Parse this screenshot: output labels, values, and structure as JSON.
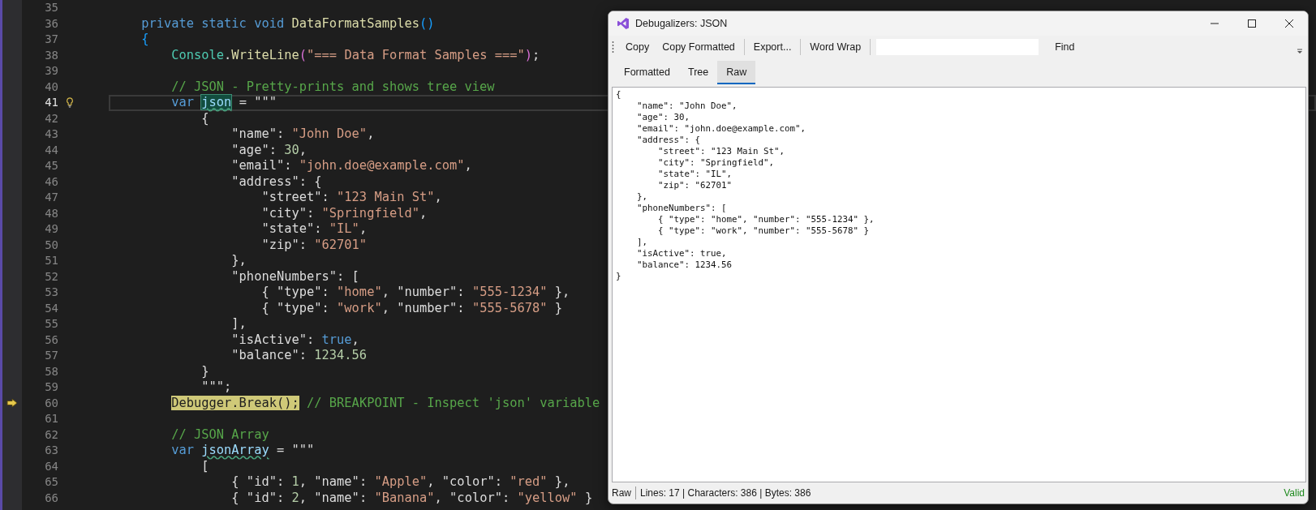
{
  "editor": {
    "lines": [
      {
        "number": "35",
        "current": false,
        "kind": "plain"
      },
      {
        "number": "36",
        "current": false,
        "kind": "plain",
        "segments": [
          {
            "kind": "keyword",
            "text": "        private static void "
          },
          {
            "kind": "method",
            "text": "DataFormatSamples"
          },
          {
            "kind": "brace1",
            "text": "()"
          }
        ]
      },
      {
        "number": "37",
        "current": false,
        "kind": "plain",
        "segments": [
          {
            "kind": "brace1",
            "text": "        {"
          }
        ]
      },
      {
        "number": "38",
        "current": false,
        "kind": "plain",
        "segments": [
          {
            "kind": "type",
            "text": "            Console"
          },
          {
            "kind": "text",
            "text": "."
          },
          {
            "kind": "method",
            "text": "WriteLine"
          },
          {
            "kind": "brace2",
            "text": "("
          },
          {
            "kind": "string",
            "text": "\"=== Data Format Samples ===\""
          },
          {
            "kind": "brace2",
            "text": ")"
          },
          {
            "kind": "text",
            "text": ";"
          }
        ]
      },
      {
        "number": "39",
        "current": false,
        "kind": "plain"
      },
      {
        "number": "40",
        "current": false,
        "kind": "plain",
        "segments": [
          {
            "kind": "comment",
            "text": "            // JSON - Pretty-prints and shows tree view"
          }
        ]
      },
      {
        "number": "41",
        "current": true,
        "kind": "lightbulb",
        "segments": [
          {
            "kind": "keyword",
            "text": "            var "
          },
          {
            "kind": "reference",
            "text": "json"
          },
          {
            "kind": "text",
            "text": " = \"\"\""
          }
        ]
      },
      {
        "number": "42",
        "current": false,
        "kind": "plain",
        "segments": [
          {
            "kind": "text",
            "text": "                {"
          }
        ]
      },
      {
        "number": "43",
        "current": false,
        "kind": "plain",
        "segments": [
          {
            "kind": "text",
            "text": "                    \"name\": "
          },
          {
            "kind": "string",
            "text": "\"John Doe\""
          },
          {
            "kind": "text",
            "text": ","
          }
        ]
      },
      {
        "number": "44",
        "current": false,
        "kind": "plain",
        "segments": [
          {
            "kind": "text",
            "text": "                    \"age\": "
          },
          {
            "kind": "number",
            "text": "30"
          },
          {
            "kind": "text",
            "text": ","
          }
        ]
      },
      {
        "number": "45",
        "current": false,
        "kind": "plain",
        "segments": [
          {
            "kind": "text",
            "text": "                    \"email\": "
          },
          {
            "kind": "string",
            "text": "\"john.doe@example.com\""
          },
          {
            "kind": "text",
            "text": ","
          }
        ]
      },
      {
        "number": "46",
        "current": false,
        "kind": "plain",
        "segments": [
          {
            "kind": "text",
            "text": "                    \"address\": {"
          }
        ]
      },
      {
        "number": "47",
        "current": false,
        "kind": "plain",
        "segments": [
          {
            "kind": "text",
            "text": "                        \"street\": "
          },
          {
            "kind": "string",
            "text": "\"123 Main St\""
          },
          {
            "kind": "text",
            "text": ","
          }
        ]
      },
      {
        "number": "48",
        "current": false,
        "kind": "plain",
        "segments": [
          {
            "kind": "text",
            "text": "                        \"city\": "
          },
          {
            "kind": "string",
            "text": "\"Springfield\""
          },
          {
            "kind": "text",
            "text": ","
          }
        ]
      },
      {
        "number": "49",
        "current": false,
        "kind": "plain",
        "segments": [
          {
            "kind": "text",
            "text": "                        \"state\": "
          },
          {
            "kind": "string",
            "text": "\"IL\""
          },
          {
            "kind": "text",
            "text": ","
          }
        ]
      },
      {
        "number": "50",
        "current": false,
        "kind": "plain",
        "segments": [
          {
            "kind": "text",
            "text": "                        \"zip\": "
          },
          {
            "kind": "string",
            "text": "\"62701\""
          }
        ]
      },
      {
        "number": "51",
        "current": false,
        "kind": "plain",
        "segments": [
          {
            "kind": "text",
            "text": "                    },"
          }
        ]
      },
      {
        "number": "52",
        "current": false,
        "kind": "plain",
        "segments": [
          {
            "kind": "text",
            "text": "                    \"phoneNumbers\": ["
          }
        ]
      },
      {
        "number": "53",
        "current": false,
        "kind": "plain",
        "segments": [
          {
            "kind": "text",
            "text": "                        { \"type\": "
          },
          {
            "kind": "string",
            "text": "\"home\""
          },
          {
            "kind": "text",
            "text": ", \"number\": "
          },
          {
            "kind": "string",
            "text": "\"555-1234\""
          },
          {
            "kind": "text",
            "text": " },"
          }
        ]
      },
      {
        "number": "54",
        "current": false,
        "kind": "plain",
        "segments": [
          {
            "kind": "text",
            "text": "                        { \"type\": "
          },
          {
            "kind": "string",
            "text": "\"work\""
          },
          {
            "kind": "text",
            "text": ", \"number\": "
          },
          {
            "kind": "string",
            "text": "\"555-5678\""
          },
          {
            "kind": "text",
            "text": " }"
          }
        ]
      },
      {
        "number": "55",
        "current": false,
        "kind": "plain",
        "segments": [
          {
            "kind": "text",
            "text": "                    ],"
          }
        ]
      },
      {
        "number": "56",
        "current": false,
        "kind": "plain",
        "segments": [
          {
            "kind": "text",
            "text": "                    \"isActive\": "
          },
          {
            "kind": "keyword",
            "text": "true"
          },
          {
            "kind": "text",
            "text": ","
          }
        ]
      },
      {
        "number": "57",
        "current": false,
        "kind": "plain",
        "segments": [
          {
            "kind": "text",
            "text": "                    \"balance\": "
          },
          {
            "kind": "number",
            "text": "1234.56"
          }
        ]
      },
      {
        "number": "58",
        "current": false,
        "kind": "plain",
        "segments": [
          {
            "kind": "text",
            "text": "                }"
          }
        ]
      },
      {
        "number": "59",
        "current": false,
        "kind": "plain",
        "segments": [
          {
            "kind": "text",
            "text": "                \"\"\";"
          }
        ]
      },
      {
        "number": "60",
        "current": false,
        "kind": "execution-arrow",
        "segments": [
          {
            "kind": "breakpoint",
            "text": "            Debugger.Break();"
          },
          {
            "kind": "comment",
            "text": " // BREAKPOINT - Inspect 'json' variable"
          }
        ]
      },
      {
        "number": "61",
        "current": false,
        "kind": "plain"
      },
      {
        "number": "62",
        "current": false,
        "kind": "plain",
        "segments": [
          {
            "kind": "comment",
            "text": "            // JSON Array"
          }
        ]
      },
      {
        "number": "63",
        "current": false,
        "kind": "plain",
        "segments": [
          {
            "kind": "keyword",
            "text": "            var "
          },
          {
            "kind": "squiggle",
            "text": "jsonArray"
          },
          {
            "kind": "text",
            "text": " = \"\"\""
          }
        ]
      },
      {
        "number": "64",
        "current": false,
        "kind": "plain",
        "segments": [
          {
            "kind": "text",
            "text": "                ["
          }
        ]
      },
      {
        "number": "65",
        "current": false,
        "kind": "plain",
        "segments": [
          {
            "kind": "text",
            "text": "                    { \"id\": "
          },
          {
            "kind": "number",
            "text": "1"
          },
          {
            "kind": "text",
            "text": ", \"name\": "
          },
          {
            "kind": "string",
            "text": "\"Apple\""
          },
          {
            "kind": "text",
            "text": ", \"color\": "
          },
          {
            "kind": "string",
            "text": "\"red\""
          },
          {
            "kind": "text",
            "text": " },"
          }
        ]
      },
      {
        "number": "66",
        "current": false,
        "kind": "plain",
        "segments": [
          {
            "kind": "text",
            "text": "                    { \"id\": "
          },
          {
            "kind": "number",
            "text": "2"
          },
          {
            "kind": "text",
            "text": ", \"name\": "
          },
          {
            "kind": "string",
            "text": "\"Banana\""
          },
          {
            "kind": "text",
            "text": ", \"color\": "
          },
          {
            "kind": "string",
            "text": "\"yellow\""
          },
          {
            "kind": "text",
            "text": " }"
          }
        ]
      }
    ]
  },
  "window": {
    "title": "Debugalizers: JSON",
    "toolbar": [
      {
        "kind": "button",
        "label": "Copy"
      },
      {
        "kind": "button",
        "label": "Copy Formatted"
      },
      {
        "kind": "separator"
      },
      {
        "kind": "button",
        "label": "Export..."
      },
      {
        "kind": "separator"
      },
      {
        "kind": "button",
        "label": "Word Wrap"
      },
      {
        "kind": "separator"
      },
      {
        "kind": "search"
      },
      {
        "kind": "button",
        "label": "Find"
      }
    ],
    "tabs": [
      {
        "label": "Formatted",
        "selected": false
      },
      {
        "label": "Tree",
        "selected": false
      },
      {
        "label": "Raw",
        "selected": true
      }
    ],
    "raw_lines": [
      "{",
      "    \"name\": \"John Doe\",",
      "    \"age\": 30,",
      "    \"email\": \"john.doe@example.com\",",
      "    \"address\": {",
      "        \"street\": \"123 Main St\",",
      "        \"city\": \"Springfield\",",
      "        \"state\": \"IL\",",
      "        \"zip\": \"62701\"",
      "    },",
      "    \"phoneNumbers\": [",
      "        { \"type\": \"home\", \"number\": \"555-1234\" },",
      "        { \"type\": \"work\", \"number\": \"555-5678\" }",
      "    ],",
      "    \"isActive\": true,",
      "    \"balance\": 1234.56",
      "}"
    ],
    "status_bar": {
      "mode": "Raw",
      "stats": "Lines: 17 | Characters: 386 | Bytes: 386",
      "validity": "Valid"
    }
  }
}
